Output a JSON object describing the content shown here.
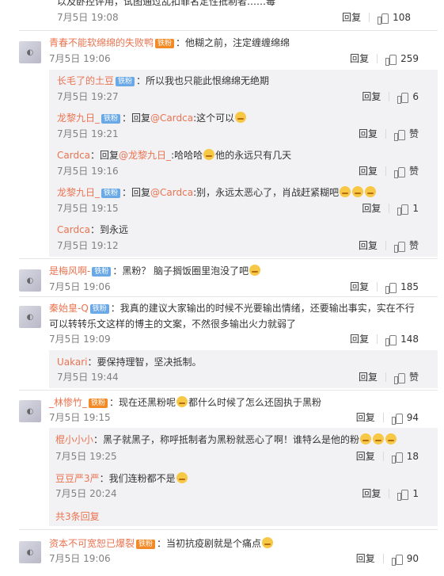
{
  "top": {
    "truncated_text": "以及卧控评用，试图通过乱扣罪名定性抵制者……毒",
    "time": "7月5日 19:08",
    "reply": "回复",
    "likes": "108"
  },
  "comments": [
    {
      "user": "青春不能软绵绵的失败鸭",
      "vip": "铁粉",
      "text": "：他糊之前，注定缠缠绵绵",
      "time": "7月5日 19:06",
      "reply": "回复",
      "likes": "259",
      "replies": [
        {
          "user": "长毛了的土豆",
          "badge": "铁粉",
          "text": "：所以我也只能此恨绵绵无绝期",
          "time": "7月5日 19:27",
          "reply": "回复",
          "likes": "6"
        },
        {
          "user": "龙黎九日_",
          "badge": "铁粉",
          "pre": "：回复",
          "mention": "@Cardca",
          "text": ":这个可以",
          "time": "7月5日 19:21",
          "reply": "回复",
          "likes": "赞"
        },
        {
          "user": "Cardca",
          "pre": "：回复",
          "mention": "@龙黎九日_",
          "text": ":哈哈哈",
          "text2": "他的永远只有几天",
          "time": "7月5日 19:16",
          "reply": "回复",
          "likes": "赞"
        },
        {
          "user": "龙黎九日_",
          "badge": "铁粉",
          "pre": "：回复",
          "mention": "@Cardca",
          "text": ":别，永远太恶心了，肖战赶紧糊吧",
          "time": "7月5日 19:15",
          "reply": "回复",
          "likes": "1"
        },
        {
          "user": "Cardca",
          "text": "：到永远",
          "time": "7月5日 19:12",
          "reply": "回复",
          "likes": "赞"
        }
      ]
    },
    {
      "user": "是梅风啊-",
      "badge": "铁粉",
      "text": "：黑粉？ 脑子搁饭圈里泡没了吧",
      "time": "7月5日 19:06",
      "reply": "回复",
      "likes": "185"
    },
    {
      "user": "秦始皇-Q",
      "badge": "铁粉",
      "text": "：我真的建议大家输出的时候不光要输出情绪，还要输出事实，实在不行",
      "text_line2": "可以转转乐文这样的博主的文案，不然很多输出火力就弱了",
      "time": "7月5日 19:09",
      "reply": "回复",
      "likes": "148",
      "replies": [
        {
          "user": "Uakari",
          "text": "：要保持理智，坚决抵制。",
          "time": "7月5日 19:44",
          "reply": "回复",
          "likes": "赞"
        }
      ]
    },
    {
      "user": "_林惨竹_",
      "vip": "铁粉",
      "text": "：现在还黑粉呢",
      "text2": "都什么时候了怎么还固执于黑粉",
      "time": "7月5日 19:15",
      "reply": "回复",
      "likes": "94",
      "replies": [
        {
          "user": "棍小小小",
          "text": "：黑子就黑子，称呼抵制者为黑粉就恶心了啊！谁特么是他的粉",
          "time": "7月5日 19:25",
          "reply": "回复",
          "likes": "18"
        },
        {
          "user": "豆豆严3严",
          "text": "：我们连粉都不是",
          "time": "7月5日 20:24",
          "reply": "回复",
          "likes": "1"
        }
      ],
      "more": "共3条回复"
    },
    {
      "user": "资本不可宽恕已爆裂",
      "vip": "铁粉",
      "text": "：当初抗疫剧就是个痛点",
      "time": "7月5日 19:06",
      "reply": "回复",
      "likes": "90"
    }
  ]
}
